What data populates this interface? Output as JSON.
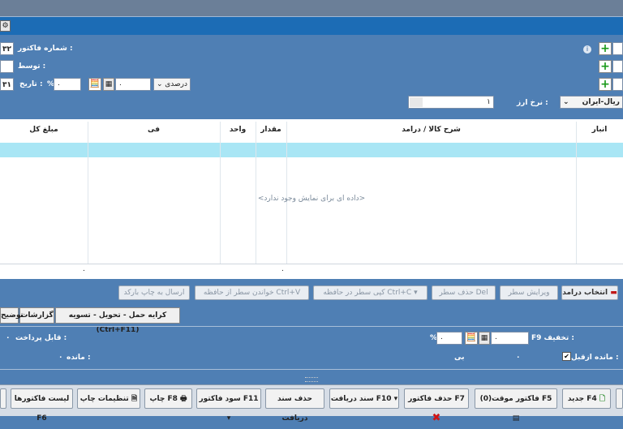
{
  "header": {
    "invoice_no_label": "شماره فاکتور :",
    "invoice_no_value": "۳۲",
    "by_label": "توسط :",
    "date_label": "تاریخ :",
    "date_value": "۳۱",
    "percent_sign": "%",
    "percent_value": "۰",
    "discount_value": "۰",
    "percent_mode": "درصدی",
    "currency_label": "نرخ ارز :",
    "currency_rate": "۱",
    "currency_name": "ریال-ایران"
  },
  "grid": {
    "columns": [
      "مبلغ کل",
      "فی",
      "واحد",
      "مقدار",
      "شرح کالا / درامد",
      "انبار"
    ],
    "empty_text": "<داده ای برای نمایش وجود ندارد>",
    "total_amount": "۰",
    "total_qty": "۰"
  },
  "toolbar": {
    "select_income": "انتخاب درامد",
    "edit_row": "ویرایش سطر",
    "delete_row": "حذف سطر Del",
    "copy_row": "کپی سطر در حافظه Ctrl+C",
    "read_row": "خواندن سطر از حافظه Ctrl+V",
    "send_barcode": "ارسال به چاپ بارکد"
  },
  "tabs": {
    "shipping": "کرایه حمل - تحویل - تسویه (Ctrl+F11)",
    "reports": "گزارشات",
    "notes": "توضیح"
  },
  "summary": {
    "payable_label": "قابل پرداخت :",
    "payable_value": "۰",
    "remain_label": "مانده :",
    "remain_value": "۰",
    "discount_label": "F9 تخفیف :",
    "discount_percent_sign": "%",
    "discount_value": "۰",
    "discount_percent_value": "۰",
    "prev_balance_label": "مانده ازقبل :",
    "prev_balance_value": "۰",
    "prev_balance_suffix": "بی",
    "prev_balance_checked": true
  },
  "bottom_buttons": {
    "new": "جدید F4",
    "temp_invoice": "فاکتور موقت(0) F5",
    "delete_invoice": "حذف فاکتور F7",
    "receive_doc": "سند دریافت F10",
    "delete_receive_doc": "حذف سند دریافت",
    "invoice_profit": "سود فاکتور F11",
    "print": "چاپ F8",
    "print_settings": "تنظیمات چاپ",
    "invoice_list": "لیست فاکتورها F6"
  }
}
